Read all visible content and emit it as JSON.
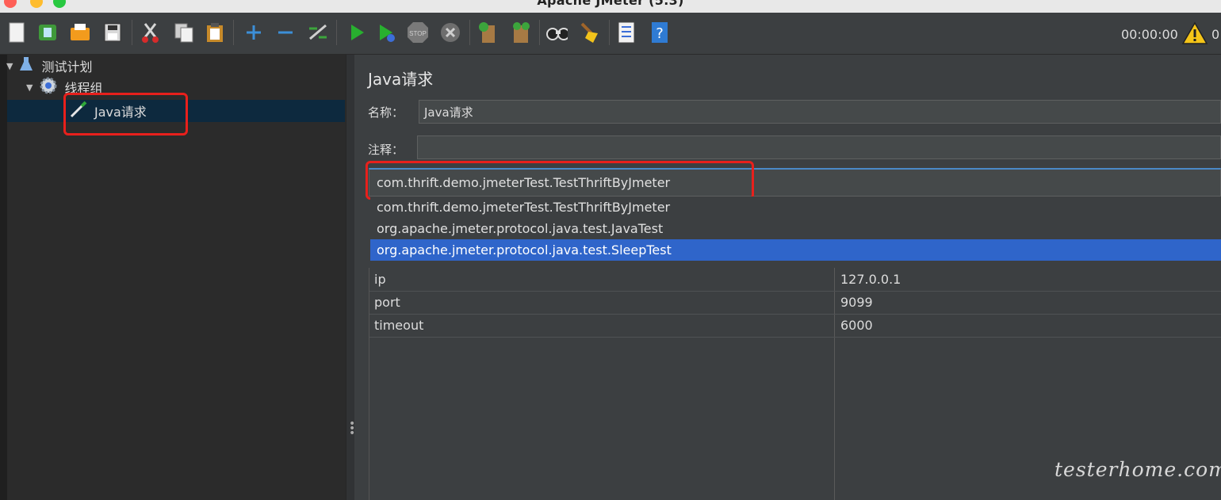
{
  "window": {
    "title": "Apache JMeter (5.3)"
  },
  "toolbar": {
    "buttons": [
      {
        "name": "new-icon"
      },
      {
        "name": "templates-icon"
      },
      {
        "name": "open-icon"
      },
      {
        "name": "save-icon"
      },
      {
        "name": "cut-icon"
      },
      {
        "name": "copy-icon"
      },
      {
        "name": "paste-icon"
      },
      {
        "name": "expand-icon"
      },
      {
        "name": "collapse-icon"
      },
      {
        "name": "toggle-icon"
      },
      {
        "name": "start-icon"
      },
      {
        "name": "start-no-pauses-icon"
      },
      {
        "name": "stop-icon"
      },
      {
        "name": "shutdown-icon"
      },
      {
        "name": "clear-icon"
      },
      {
        "name": "clear-all-icon"
      },
      {
        "name": "search-icon"
      },
      {
        "name": "reset-search-icon"
      },
      {
        "name": "function-helper-icon"
      },
      {
        "name": "help-icon"
      }
    ],
    "timer": "00:00:00",
    "warning_count": "0"
  },
  "tree": {
    "items": [
      {
        "label": "测试计划",
        "icon": "flask-icon"
      },
      {
        "label": "线程组",
        "icon": "gear-icon"
      },
      {
        "label": "Java请求",
        "icon": "pipette-icon"
      }
    ]
  },
  "panel": {
    "title": "Java请求",
    "name_label": "名称：",
    "name_value": "Java请求",
    "comment_label": "注释：",
    "comment_value": "",
    "classname_selected": "com.thrift.demo.jmeterTest.TestThriftByJmeter",
    "classname_options": [
      "com.thrift.demo.jmeterTest.TestThriftByJmeter",
      "org.apache.jmeter.protocol.java.test.JavaTest",
      "org.apache.jmeter.protocol.java.test.SleepTest"
    ],
    "params": [
      {
        "name": "ip",
        "value": "127.0.0.1"
      },
      {
        "name": "port",
        "value": "9099"
      },
      {
        "name": "timeout",
        "value": "6000"
      }
    ]
  },
  "watermark": "testerhome.com",
  "colors": {
    "selection": "#0d293e",
    "dropdown_highlight": "#2f65ca",
    "annotation_red": "#e8201c",
    "focus": "#4a88c7"
  }
}
